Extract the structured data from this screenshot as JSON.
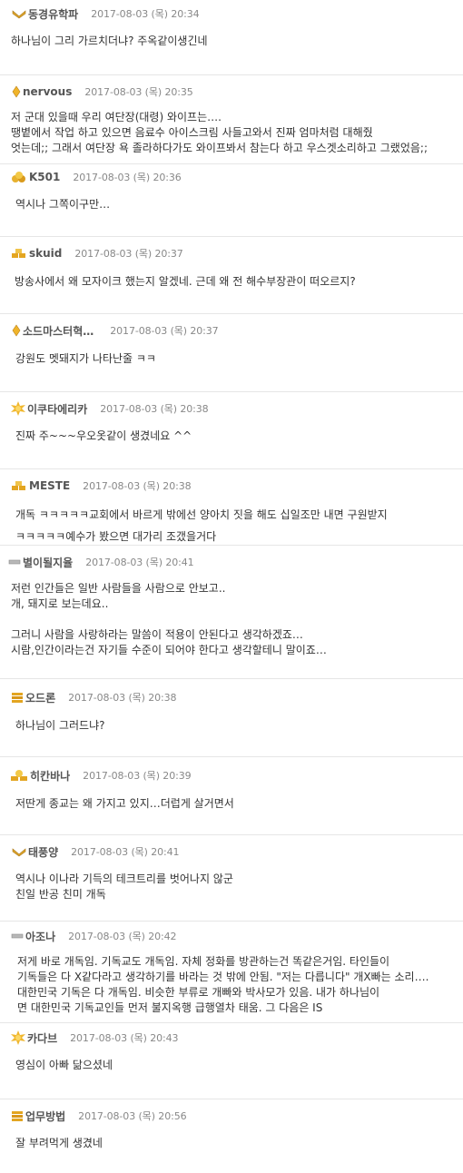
{
  "comments": [
    {
      "icon": "wing-rank-icon",
      "nick": "동경유학파",
      "date": "2017-08-03 (목) 20:34",
      "lines": [
        "하나님이 그리 가르치더냐? 주옥같이생긴네"
      ]
    },
    {
      "icon": "diamond-rank-icon",
      "nick": "nervous",
      "date": "2017-08-03 (목) 20:35",
      "lines": [
        "저 군대 있을때 우리 여단장(대령) 와이프는….",
        "땡볕에서 작업 하고 있으면 음료수 아이스크림 사들고와서 진짜 엄마처럼 대해줬",
        "엇는데;; 그래서 여단장 욕 졸라하다가도 와이프봐서 참는다 하고 우스겟소리하고 그랬었음;;"
      ]
    },
    {
      "icon": "gold-cluster-icon",
      "nick": "K501",
      "date": "2017-08-03 (목) 20:36",
      "lines": [
        "역시나 그쪽이구만…"
      ]
    },
    {
      "icon": "gold-bars-icon",
      "nick": "skuid",
      "date": "2017-08-03 (목) 20:37",
      "lines": [
        "방송사에서 왜 모자이크 했는지 알겠네. 근데 왜 전 해수부장관이 떠오르지?"
      ]
    },
    {
      "icon": "diamond-rank-icon",
      "nick": "소드마스터혁…",
      "date": "2017-08-03 (목) 20:37",
      "lines": [
        "강원도 멧돼지가 나타난줄 ㅋㅋ"
      ]
    },
    {
      "icon": "sun-rank-icon",
      "nick": "이쿠타에리카",
      "date": "2017-08-03 (목) 20:38",
      "lines": [
        "진짜 주~~~우오옷같이 생겼네요 ^^"
      ]
    },
    {
      "icon": "gold-bars-icon",
      "nick": "MESTE",
      "date": "2017-08-03 (목) 20:38",
      "lines": [
        "개독 ㅋㅋㅋㅋㅋ교회에서 바르게 밖에선 양아치 짓을 해도 십일조만 내면 구원받지",
        "ㅋㅋㅋㅋㅋ예수가 봤으면 대가리 조갰을거다"
      ]
    },
    {
      "icon": "silver-bar-icon",
      "nick": "별이될지율",
      "date": "2017-08-03 (목) 20:41",
      "lines": [
        "저런 인간들은 일반 사람들을 사람으로 안보고..",
        "개, 돼지로 보는데요..",
        "",
        "그러니 사람을 사랑하라는 말씀이 적용이 안된다고 생각하겠죠…",
        "시람,인간이라는건 자기들 수준이 되어야 한다고 생각할테니 말이죠…"
      ]
    },
    {
      "icon": "gold-stack-icon",
      "nick": "오드론",
      "date": "2017-08-03 (목) 20:38",
      "lines": [
        "하나님이 그러드냐?"
      ]
    },
    {
      "icon": "gold-pile-icon",
      "nick": "히칸바나",
      "date": "2017-08-03 (목) 20:39",
      "lines": [
        "저딴게 종교는 왜 가지고 있지…더럽게 살거면서"
      ]
    },
    {
      "icon": "wing-rank-icon",
      "nick": "태풍양",
      "date": "2017-08-03 (목) 20:41",
      "lines": [
        "역시나 이나라 기득의 테크트리를 벗어나지 않군",
        "친일 반공 친미 개독"
      ]
    },
    {
      "icon": "silver-bar-icon",
      "nick": "아조나",
      "date": "2017-08-03 (목) 20:42",
      "lines": [
        "저게 바로 개독임. 기독교도 개독임. 자체 정화를 방관하는건 똑같은거임. 타인들이",
        "기독들은 다 X같다라고 생각하기를 바라는 것 밖에 안됨. \"저는 다릅니다\" 개X빠는 소리….",
        "대한민국 기독은 다 개독임. 비슷한 부류로 개빠와 박사모가 있음. 내가 하나님이",
        "면 대한민국 기독교인들 먼저 불지옥행 급행열차 태움. 그 다음은 IS"
      ]
    },
    {
      "icon": "sun-rank-icon",
      "nick": "카다브",
      "date": "2017-08-03 (목) 20:43",
      "lines": [
        "영심이 아빠 닮으셨네"
      ]
    },
    {
      "icon": "gold-stack-icon",
      "nick": "업무방법",
      "date": "2017-08-03 (목) 20:56",
      "lines": [
        "잘 부려먹게 생겼네"
      ]
    }
  ]
}
